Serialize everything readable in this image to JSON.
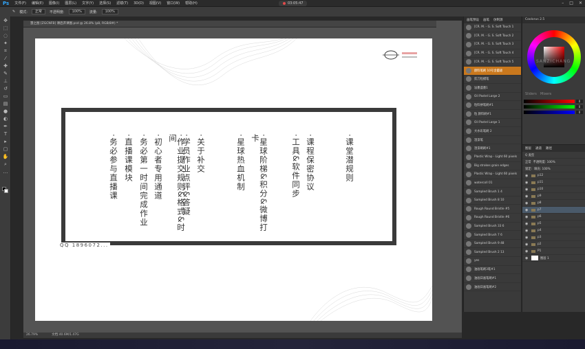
{
  "app": {
    "logo": "Ps"
  },
  "menu": [
    "文件(F)",
    "编辑(E)",
    "图像(I)",
    "图层(L)",
    "文字(Y)",
    "选择(S)",
    "滤镜(T)",
    "3D(D)",
    "视图(V)",
    "窗口(W)",
    "帮助(H)"
  ],
  "recording": {
    "time": "03:05:47"
  },
  "options": {
    "mode_label": "模式:",
    "mode_value": "正常",
    "opacity_label": "不透明度:",
    "opacity_value": "100%",
    "flow_label": "流量:",
    "flow_value": "100%"
  },
  "document": {
    "tab_title": "慧之图 [ZGCNFB] 课后开课图.psd @ 26.8% (p8, RGB/8#) *",
    "columns": [
      "·课堂潜规则",
      "·课程保密协议",
      "·工具&软件同步",
      "·星球阶梯&积分&微博打卡",
      "·星球热血机制",
      "·关于补交",
      "·学员作业点评&答疑",
      "·作业提交规则&格式&时间",
      "·初心者专用通道",
      "·务必第一时间完成作业",
      "·直播课模块",
      "·务必参与直播课"
    ],
    "qq_text": "QQ 1896072..."
  },
  "status": {
    "zoom": "26.79%",
    "doc_size": "文档:40.6M/1.47G"
  },
  "brush_panel": {
    "tabs": [
      "画笔预设",
      "画笔",
      "仿制源"
    ],
    "brushes": [
      "[CR. M. - G. S. Soft Touch 1",
      "[CR. M. - G. S. Soft Touch 2",
      "[CR. M. - G. S. Soft Touch 3",
      "[CR. M. - G. S. Soft Touch 4",
      "[CR. M. - G. S. Soft Touch 5",
      "颜料笔刷 10号含蓄级",
      "剪刀粒模笔",
      "溢墨盛墨1",
      "Oil Pastel Large 2",
      "粒料拼笔刷#1",
      "粒 颜料刷#1",
      "Oil Pastel Large 1",
      "大水彩笔刷 2",
      "湿漆笔",
      "湿漆刷刷#1",
      "Plastic Wrap - Light 60 pixels",
      "Big strokes grain edges",
      "Plastic Wrap - Light 60 pixels",
      "watercolI 01",
      "Sampled Brush 1 4",
      "Sampled Brush 8 10",
      "Rough Round Bristle #5",
      "Rough Round Bristle #6",
      "Sampled Brush 33 6",
      "Sampled Brush 7 6",
      "Sampled Brush 9 48",
      "Sampled Brush 2 13",
      "yes",
      "油画笔刷3笔#1",
      "油画日画笔刷#1",
      "油画日画笔刷#2"
    ],
    "selected_index": 5
  },
  "color_panel": {
    "title": "Coolorus 2.5",
    "slider_values": [
      "0",
      "0",
      "0"
    ],
    "tabs": [
      "Sliders",
      "Mixers"
    ]
  },
  "layers_panel": {
    "tabs": [
      "图层",
      "通道",
      "路径"
    ],
    "kind_label": "Q 类型",
    "blend": "正常",
    "opacity": "不透明度: 100%",
    "lock": "锁定:",
    "fill": "填充: 100%",
    "layers": [
      "p12",
      "p11",
      "p10",
      "p9",
      "p8",
      "p7",
      "p6",
      "p5",
      "p4",
      "p3",
      "p2",
      "P1",
      "图层 1"
    ],
    "selected_index": 5
  },
  "watermark": {
    "text": "SANZICHANG"
  }
}
